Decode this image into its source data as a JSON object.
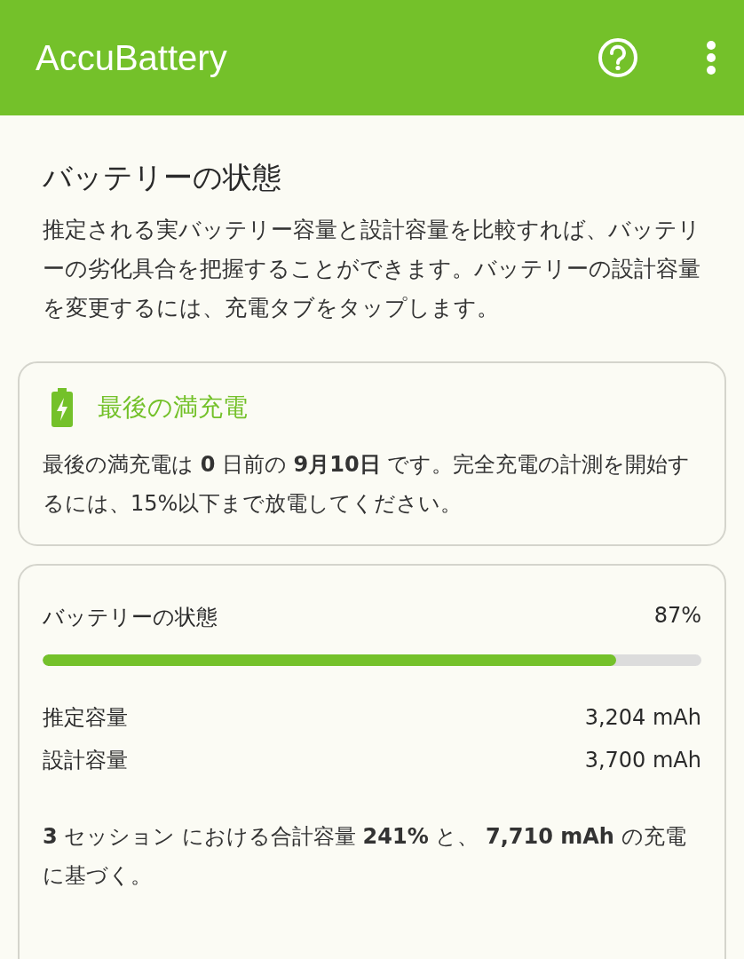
{
  "app_bar": {
    "title": "AccuBattery"
  },
  "section": {
    "title": "バッテリーの状態",
    "description": "推定される実バッテリー容量と設計容量を比較すれば、バッテリーの劣化具合を把握することができます。バッテリーの設計容量を変更するには、充電タブをタップします。"
  },
  "last_full_charge": {
    "title": "最後の満充電",
    "text": "最後の満充電は **0** 日前の **9月10日** です。完全充電の計測を開始するには、15%以下まで放電してください。"
  },
  "health": {
    "label": "バッテリーの状態",
    "reading": "87%",
    "level": 0.87,
    "rows": [
      {
        "label": "推定容量",
        "value": "3,204 mAh"
      },
      {
        "label": "設計容量",
        "value": "3,700 mAh"
      }
    ],
    "note": "**3** セッション における合計容量 **241%** と、 **7,710 mAh** の充電に基づく。"
  }
}
